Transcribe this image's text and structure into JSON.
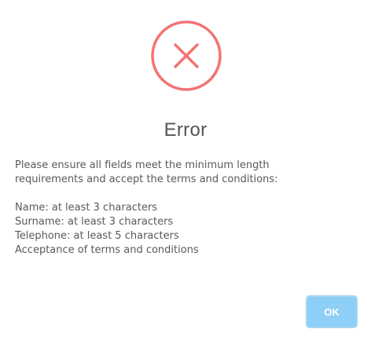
{
  "dialog": {
    "icon": "error-x-icon",
    "title": "Error",
    "intro_line1": "Please ensure all fields meet the minimum length",
    "intro_line2": "requirements and accept the terms and conditions:",
    "requirements": [
      "Name: at least 3 characters",
      "Surname: at least 3 characters",
      "Telephone: at least 5 characters",
      "Acceptance of terms and conditions"
    ],
    "ok_label": "OK"
  },
  "colors": {
    "error_icon": "#f27474",
    "title_text": "#545454",
    "body_text": "#595959",
    "ok_button_bg": "#8dcff6",
    "ok_button_border": "#a7d6f2"
  }
}
